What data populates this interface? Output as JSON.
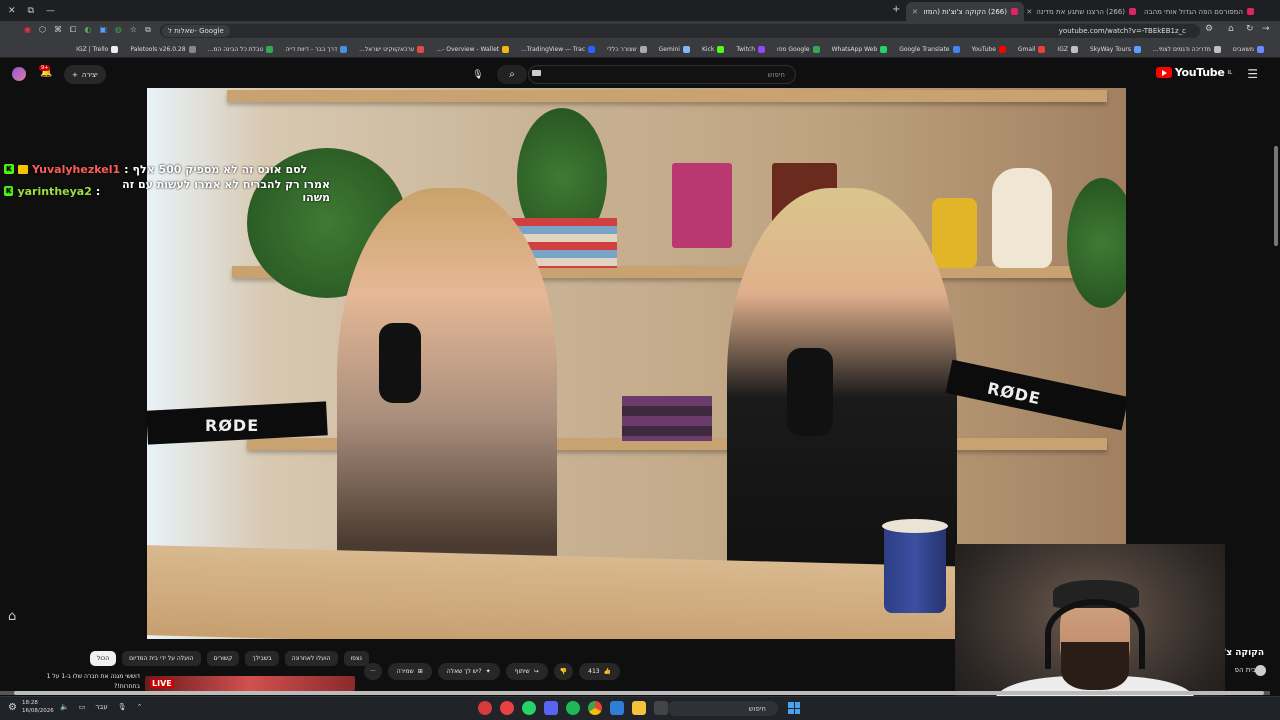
{
  "browser": {
    "window_controls": [
      "⟐",
      "⧉",
      "—"
    ],
    "tabs": [
      {
        "title": "המפורסם הפה הגדול אותי מהבה",
        "active": false
      },
      {
        "title": "(266) הרצנו שתגע את מדינה",
        "active": false
      },
      {
        "title": "(266) הקוקה צ'וצ'ות (המזו",
        "active": true
      }
    ],
    "new_tab": "+",
    "url": "youtube.com/watch?v=-TBEkEB1z_c",
    "search_chip": "שאלות ל- Google",
    "bookmarks": [
      {
        "label": "משאבים",
        "color": "#6b8cff"
      },
      {
        "label": "מדריכה ודגמים לצמי...",
        "color": "#c0c0c0"
      },
      {
        "label": "SkyWay Tours",
        "color": "#5aa0ff"
      },
      {
        "label": "IGZ",
        "color": "#c0c0c0"
      },
      {
        "label": "Gmail",
        "color": "#ea4335"
      },
      {
        "label": "YouTube",
        "color": "#ff0000"
      },
      {
        "label": "Google Translate",
        "color": "#4285f4"
      },
      {
        "label": "WhatsApp Web",
        "color": "#25d366"
      },
      {
        "label": "Google מפו",
        "color": "#34a853"
      },
      {
        "label": "Twitch",
        "color": "#9146ff"
      },
      {
        "label": "Kick",
        "color": "#53fc18"
      },
      {
        "label": "Gemini",
        "color": "#8ab4f8"
      },
      {
        "label": "שצורר כללי",
        "color": "#aaa"
      },
      {
        "label": "TradingView — Trac...",
        "color": "#2962ff"
      },
      {
        "label": "Overview - Wallet -...",
        "color": "#f0b90b"
      },
      {
        "label": "ערכאקווקיט ישראל...",
        "color": "#e34a4a"
      },
      {
        "label": "דרך בבר - דיוות דייה",
        "color": "#4a90e2"
      },
      {
        "label": "טבלת כל הבינה המ...",
        "color": "#34a853"
      },
      {
        "label": "Paletools v26.0.28",
        "color": "#888"
      },
      {
        "label": "IGZ | Trello",
        "color": "#eee"
      }
    ]
  },
  "youtube": {
    "logo": "YouTube",
    "logo_sup": "IL",
    "search_placeholder": "חיפוש",
    "create_label": "יצירה",
    "notif_count": "9+",
    "video": {
      "title": "הקוקה צ'וצ'ות (המזוי",
      "channel": "בית הפ",
      "likes": "413"
    },
    "chat": [
      {
        "user": "Yuvalyhezkel1",
        "message": "לסם אונס זה לא מספיק 500 אלף"
      },
      {
        "user": "yarintheya2",
        "message": "אמרו רק להבריח לא אמרו לעשות עם זה משהו"
      }
    ],
    "actions": {
      "ask": "יש לך שאלה?",
      "share": "שיתוף",
      "save": "שמירה",
      "more": "···"
    },
    "chips": [
      "הכול",
      "הועלה על ידי בית המדיום",
      "קשורים",
      "בשבילך",
      "הועלו לאחרונה",
      "נצפו"
    ],
    "live_card": {
      "badge": "LIVE",
      "title": "דוששי מגנה את חברה שלו ב-1 על 1 בתחרות!?"
    }
  },
  "taskbar": {
    "search_placeholder": "חיפוש",
    "time": "18:28",
    "date": "16/08/2026",
    "lang": "עבר"
  },
  "colors": {
    "accent": "#ff0000",
    "bg": "#0f0f0f",
    "kick_green": "#53fc18",
    "chip_bg": "#272727"
  }
}
